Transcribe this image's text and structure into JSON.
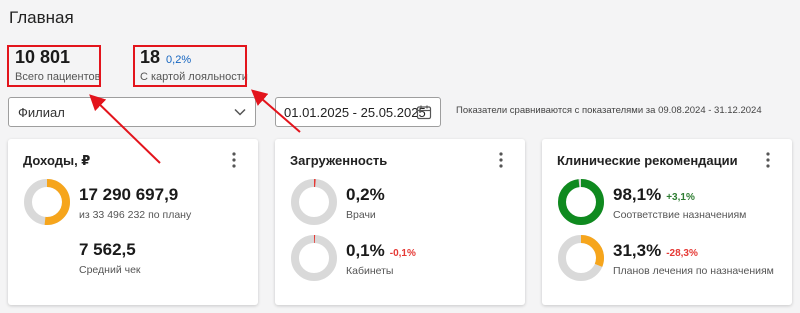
{
  "page": {
    "title": "Главная"
  },
  "header_stats": {
    "patients": {
      "value": "10 801",
      "label": "Всего пациентов"
    },
    "loyalty": {
      "value": "18",
      "percent": "0,2%",
      "label": "С картой лояльности"
    }
  },
  "filters": {
    "branch_label": "Филиал",
    "date_range": "01.01.2025 - 25.05.2025",
    "compare_note": "Показатели сравниваются с показателями за 09.08.2024 - 31.12.2024"
  },
  "cards": {
    "income": {
      "title": "Доходы, ₽",
      "main_value": "17 290 697,9",
      "main_label": "из 33 496 232 по плану",
      "main_fraction": 0.516,
      "secondary_value": "7 562,5",
      "secondary_label": "Средний чек"
    },
    "load": {
      "title": "Загруженность",
      "doctors_value": "0,2%",
      "doctors_label": "Врачи",
      "doctors_fraction": 0.002,
      "rooms_value": "0,1%",
      "rooms_delta": "-0,1%",
      "rooms_label": "Кабинеты",
      "rooms_fraction": 0.001
    },
    "clinical": {
      "title": "Клинические рекомендации",
      "compliance_value": "98,1%",
      "compliance_delta": "+3,1%",
      "compliance_label": "Соответствие назначениям",
      "compliance_fraction": 0.981,
      "plans_value": "31,3%",
      "plans_delta": "-28,3%",
      "plans_label": "Планов лечения по назначениям",
      "plans_fraction": 0.313
    }
  },
  "colors": {
    "orange": "#f6a51c",
    "green": "#0f8a1f",
    "ring_bg": "#d9d9d9",
    "tick_red": "#e53935",
    "positive": "#2e7d32",
    "negative": "#e53935",
    "annotation": "#e3141c"
  }
}
